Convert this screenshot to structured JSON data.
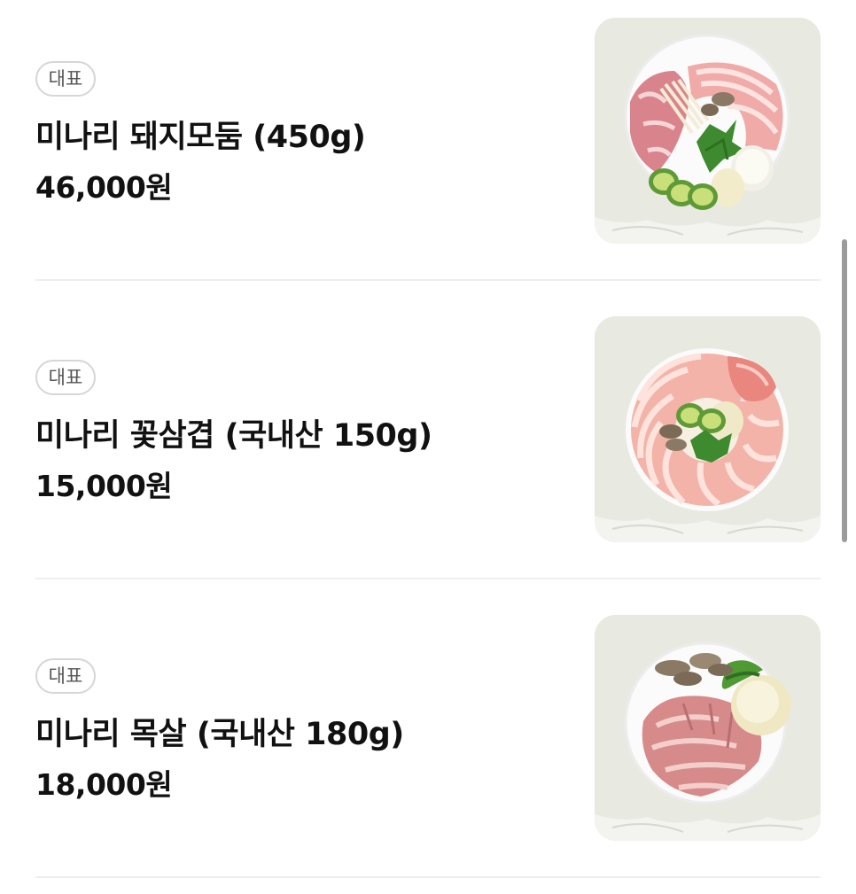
{
  "menu": {
    "items": [
      {
        "badge": "대표",
        "name": "미나리 돼지모둠 (450g)",
        "price": "46,000원",
        "image": "pork-assortment-platter-image"
      },
      {
        "badge": "대표",
        "name": "미나리 꽃삼겹 (국내산 150g)",
        "price": "15,000원",
        "image": "pork-belly-platter-image"
      },
      {
        "badge": "대표",
        "name": "미나리 목살 (국내산 180g)",
        "price": "18,000원",
        "image": "pork-neck-platter-image"
      }
    ]
  },
  "colors": {
    "text": "#111111",
    "badge_text": "#555555",
    "badge_border": "#d6d6d6",
    "divider": "#eeeeee",
    "image_background": "#e7e8e0"
  }
}
